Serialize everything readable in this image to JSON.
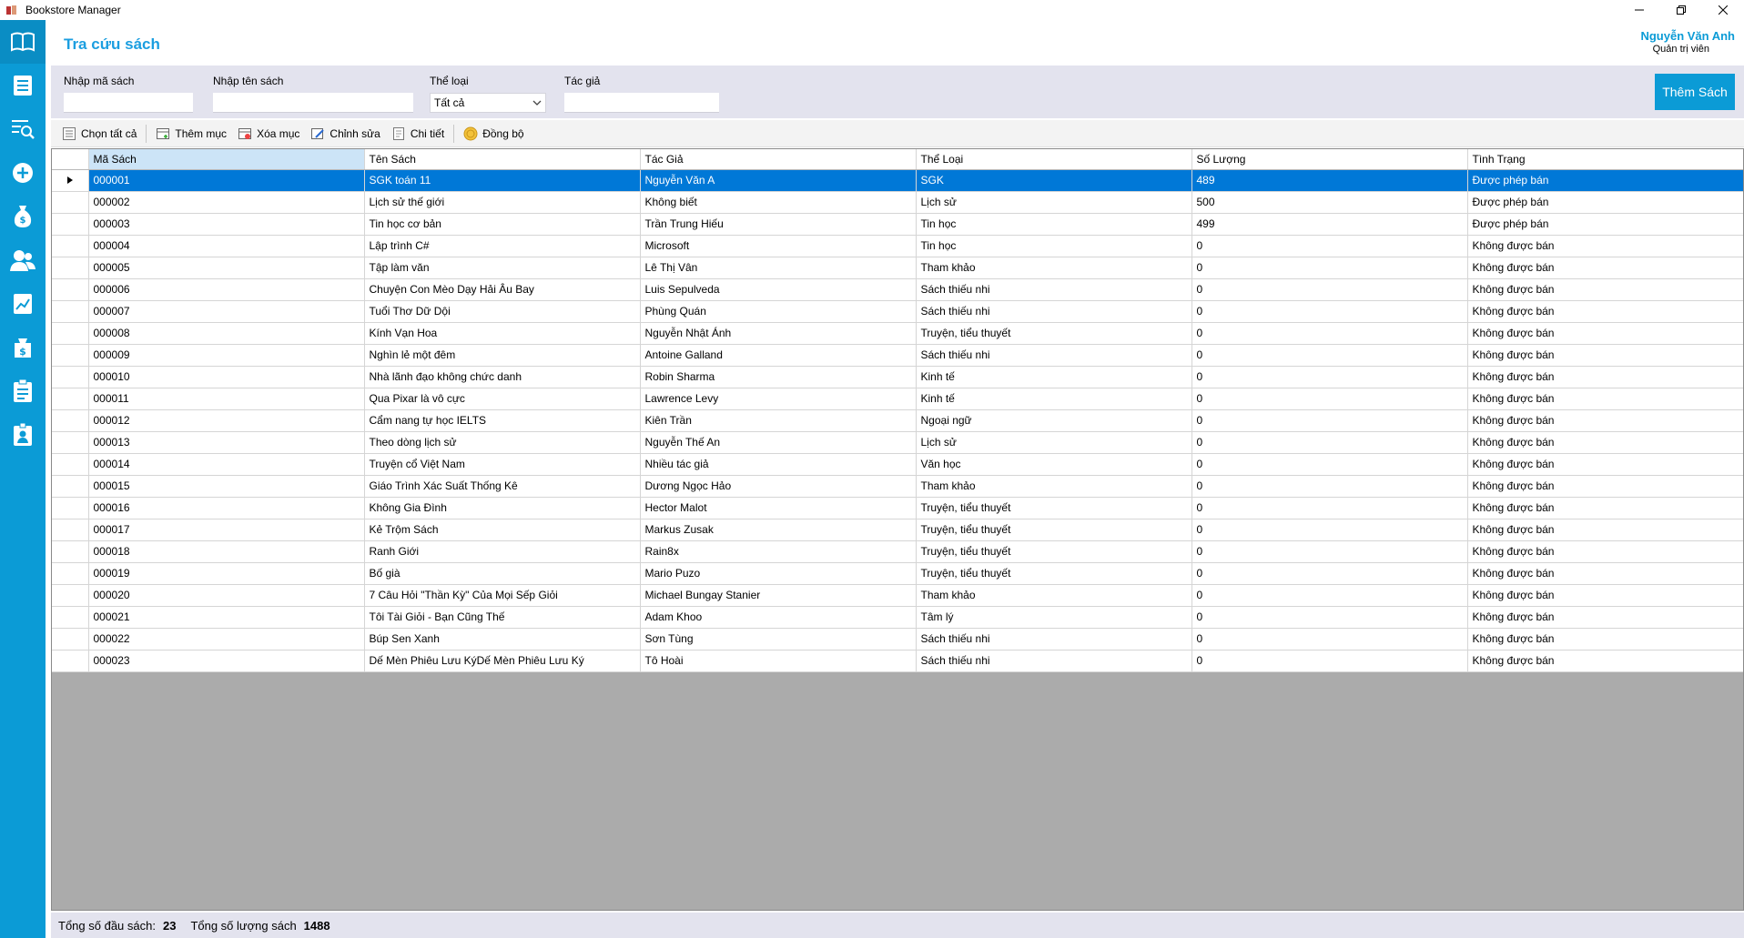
{
  "window": {
    "title": "Bookstore Manager"
  },
  "header": {
    "page_title": "Tra cứu sách",
    "user_name": "Nguyễn Văn Anh",
    "user_role": "Quản trị viên"
  },
  "sidebar": {
    "icons": [
      "book-icon",
      "list-icon",
      "search-list-icon",
      "plus-circle-icon",
      "money-bag-icon",
      "users-icon",
      "chart-icon",
      "dollar-bag-icon",
      "clipboard-icon",
      "badge-icon"
    ]
  },
  "filters": {
    "ma_sach_label": "Nhập mã sách",
    "ten_sach_label": "Nhập tên sách",
    "the_loai_label": "Thể loại",
    "the_loai_value": "Tất cả",
    "tac_gia_label": "Tác giả",
    "add_button": "Thêm Sách"
  },
  "toolbar": {
    "select_all": "Chọn tất cả",
    "add_item": "Thêm mục",
    "delete_item": "Xóa mục",
    "edit": "Chỉnh sửa",
    "detail": "Chi tiết",
    "sync": "Đồng bộ"
  },
  "table": {
    "columns": [
      "Mã Sách",
      "Tên Sách",
      "Tác Giả",
      "Thể Loại",
      "Số Lượng",
      "Tình Trạng"
    ],
    "rows": [
      [
        "000001",
        "SGK toán 11",
        "Nguyễn Văn A",
        "SGK",
        "489",
        "Được phép bán"
      ],
      [
        "000002",
        "Lịch sử thế giới",
        "Không biết",
        "Lịch sử",
        "500",
        "Được phép bán"
      ],
      [
        "000003",
        "Tin học cơ bản",
        "Trần Trung Hiếu",
        "Tin học",
        "499",
        "Được phép bán"
      ],
      [
        "000004",
        "Lập trình C#",
        "Microsoft",
        "Tin học",
        "0",
        "Không được bán"
      ],
      [
        "000005",
        "Tập làm văn",
        "Lê Thị Vân",
        "Tham khảo",
        "0",
        "Không được bán"
      ],
      [
        "000006",
        "Chuyện Con Mèo Dạy Hải Âu Bay",
        "Luis Sepulveda",
        "Sách thiếu nhi",
        "0",
        "Không được bán"
      ],
      [
        "000007",
        "Tuổi Thơ Dữ Dội",
        "Phùng Quán",
        "Sách thiếu nhi",
        "0",
        "Không được bán"
      ],
      [
        "000008",
        "Kính Vạn Hoa",
        "Nguyễn Nhật Ánh",
        "Truyện, tiểu thuyết",
        "0",
        "Không được bán"
      ],
      [
        "000009",
        "Nghìn lẻ một đêm",
        "Antoine Galland",
        "Sách thiếu nhi",
        "0",
        "Không được bán"
      ],
      [
        "000010",
        "Nhà lãnh đạo không chức danh",
        "Robin Sharma",
        "Kinh tế",
        "0",
        "Không được bán"
      ],
      [
        "000011",
        "Qua Pixar là vô cực",
        "Lawrence Levy",
        "Kinh tế",
        "0",
        "Không được bán"
      ],
      [
        "000012",
        "Cẩm nang tự học IELTS",
        "Kiên Trần",
        "Ngoại ngữ",
        "0",
        "Không được bán"
      ],
      [
        "000013",
        "Theo dòng lịch sử",
        "Nguyễn Thế An",
        "Lịch sử",
        "0",
        "Không được bán"
      ],
      [
        "000014",
        "Truyện cổ Việt Nam",
        "Nhiều tác giả",
        "Văn học",
        "0",
        "Không được bán"
      ],
      [
        "000015",
        "Giáo Trình Xác Suất Thống Kê",
        "Dương Ngọc Hảo",
        "Tham khảo",
        "0",
        "Không được bán"
      ],
      [
        "000016",
        "Không Gia Đình",
        "Hector Malot",
        "Truyện, tiểu thuyết",
        "0",
        "Không được bán"
      ],
      [
        "000017",
        "Kẻ Trộm Sách",
        "Markus Zusak",
        "Truyện, tiểu thuyết",
        "0",
        "Không được bán"
      ],
      [
        "000018",
        "Ranh Giới",
        "Rain8x",
        "Truyện, tiểu thuyết",
        "0",
        "Không được bán"
      ],
      [
        "000019",
        "Bố già",
        "Mario Puzo",
        "Truyện, tiểu thuyết",
        "0",
        "Không được bán"
      ],
      [
        "000020",
        "7 Câu Hỏi \"Thần Kỳ\" Của Mọi Sếp Giỏi",
        "Michael Bungay Stanier",
        "Tham khảo",
        "0",
        "Không được bán"
      ],
      [
        "000021",
        "Tôi Tài Giỏi - Bạn Cũng Thế",
        "Adam Khoo",
        "Tâm lý",
        "0",
        "Không được bán"
      ],
      [
        "000022",
        "Búp Sen Xanh",
        "Sơn Tùng",
        "Sách thiếu nhi",
        "0",
        "Không được bán"
      ],
      [
        "000023",
        "Dế Mèn Phiêu Lưu KýDế Mèn Phiêu Lưu Ký",
        "Tô Hoài",
        "Sách thiếu nhi",
        "0",
        "Không được bán"
      ]
    ]
  },
  "status": {
    "total_titles_label": "Tổng số đầu sách:",
    "total_titles": "23",
    "total_qty_label": "Tổng số lượng sách",
    "total_qty": "1488"
  },
  "colors": {
    "accent": "#0b9bd6",
    "selection": "#0078d7",
    "panel": "#e3e3ee",
    "empty_grid": "#ababab"
  }
}
